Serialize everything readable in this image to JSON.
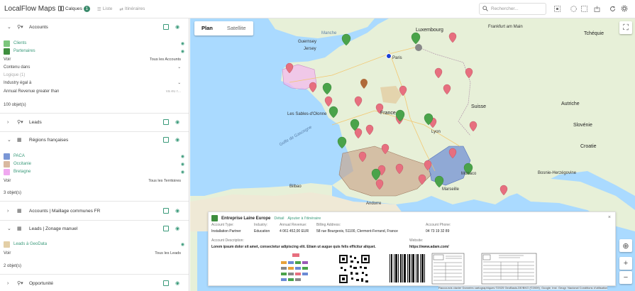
{
  "app": {
    "title": "LocalFlow Maps"
  },
  "tabs": [
    {
      "label": "Calques",
      "badge": "1"
    },
    {
      "label": "Liste"
    },
    {
      "label": "Itinéraires"
    }
  ],
  "search": {
    "placeholder": "Rechercher..."
  },
  "accounts": {
    "title": "Accounts",
    "layers": [
      {
        "label": "Clients",
        "color": "#7cc67c"
      },
      {
        "label": "Partenaires",
        "color": "#3e8e3e"
      }
    ],
    "voir_label": "Voir",
    "voir_value": "Tous les Accounts",
    "filter_op": "Contenu dans",
    "logic": "Logique (1)",
    "industry_filter": "Industry égal à",
    "revenue_filter": "Annual Revenue greater than",
    "revenue_value": "va eu r...",
    "count": "100 objet(s)"
  },
  "leads": {
    "title": "Leads"
  },
  "regions": {
    "title": "Régions françaises",
    "layers": [
      {
        "label": "PACA",
        "color": "#7b97d6"
      },
      {
        "label": "Occitanie",
        "color": "#d9b9a0"
      },
      {
        "label": "Bretagne",
        "color": "#f0a8f0"
      }
    ],
    "voir_label": "Voir",
    "voir_value": "Tous les Territoires",
    "count": "3 objet(s)"
  },
  "accounts_maillage": {
    "title": "Accounts | Maillage communes FR"
  },
  "leads_zonage": {
    "title": "Leads | Zonage manuel",
    "layers": [
      {
        "label": "Leads à GeoData",
        "color": "#e3cfa6"
      }
    ],
    "voir_label": "Voir",
    "voir_value": "Tous les Leads",
    "count": "2 objet(s)"
  },
  "opportunites": {
    "title": "Opportunité"
  },
  "map": {
    "mode_plan": "Plan",
    "mode_satellite": "Satellite",
    "places": {
      "luxembourg": "Luxembourg",
      "frankfurt": "Frankfurt am Main",
      "czech": "Tchéquie",
      "guernsey": "Guernsey",
      "jersey": "Jersey",
      "paris": "Paris",
      "france": "France",
      "suisse": "Suisse",
      "autriche": "Autriche",
      "slovenie": "Slovénie",
      "croatie": "Croatie",
      "lyon": "Lyon",
      "monaco": "Monaco",
      "marseille": "Marseille",
      "bilbao": "Bilbao",
      "andorre": "Andorre",
      "sables": "Les Sables-d'Olonne",
      "bosnie": "Bosnie-Herzégovine",
      "golfe": "Golfe de Gascogne",
      "manche": "Manche"
    },
    "attribution": "Raccourcis clavier   Données cartographiques ©2025 GeoBasis-DE/BKG (©2009), Google, Inst. Geogr. Nacional   Conditions d'utilisation"
  },
  "card": {
    "name": "Entreprise Laine Europe",
    "action_detail": "Détail",
    "action_add": "Ajouter à l'itinéraire",
    "close": "×",
    "fields": {
      "account_type_k": "Account Type:",
      "account_type_v": "Installation Partner",
      "industry_k": "Industry:",
      "industry_v": "Education",
      "revenue_k": "Annual Revenue:",
      "revenue_v": "4 061 452,00 EUR",
      "billing_k": "Billing Address:",
      "billing_v": "58 rue Bourgeois, 51100, Clermont-Ferrand, France",
      "phone_k": "Account Phone:",
      "phone_v": "04 73 19 32 89",
      "desc_k": "Account Description:",
      "desc_v": "Lorem ipsum dolor sit amet, consectetur adipiscing elit. Etiam ut augue quis felis efficitur aliquet.",
      "web_k": "Website:",
      "web_v": "https://www.adam.com/"
    }
  },
  "colors": {
    "accent": "#3a9a7a",
    "pin_red": "#e76f7f",
    "pin_green": "#4aa34a",
    "water": "#aadaff",
    "land": "#e7f0d8"
  }
}
